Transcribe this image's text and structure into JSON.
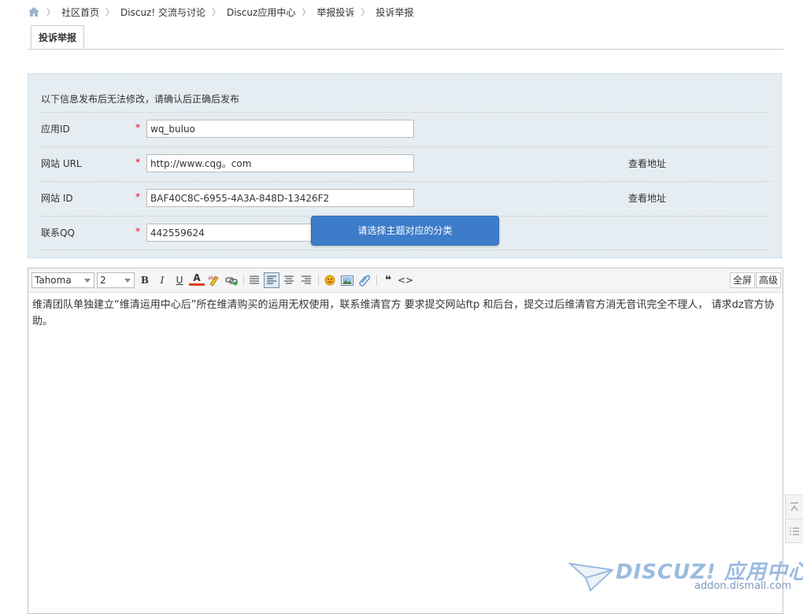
{
  "breadcrumb": {
    "items": [
      "社区首页",
      "Discuz! 交流与讨论",
      "Discuz应用中心",
      "举报投诉",
      "投诉举报"
    ],
    "separator": "〉"
  },
  "tab": {
    "label": "投诉举报"
  },
  "form": {
    "notice": "以下信息发布后无法修改，请确认后正确后发布",
    "required_mark": "*",
    "rows": [
      {
        "label": "应用ID",
        "value": "wq_buluo",
        "link": ""
      },
      {
        "label": "网站 URL",
        "value": "http://www.cqg。com",
        "link": "查看地址"
      },
      {
        "label": "网站 ID",
        "value": "BAF40C8C-6955-4A3A-848D-13426F2",
        "link": "查看地址"
      },
      {
        "label": "联系QQ",
        "value": "442559624",
        "link": ""
      }
    ]
  },
  "tooltip": {
    "text": "请选择主题对应的分类"
  },
  "editor": {
    "font_family": "Tahoma",
    "font_size": "2",
    "fullscreen_label": "全屏",
    "advanced_label": "高级",
    "bold_label": "B",
    "italic_label": "I",
    "underline_label": "U",
    "fontcolor_label": "A",
    "quote_label": "❝",
    "code_label": "<>",
    "content": "维清团队单独建立“维清运用中心后”所在维清购买的运用无权使用，联系维清官方  要求提交网站ftp 和后台，提交过后维清官方消无音讯完全不理人， 请求dz官方协助。"
  },
  "watermark": {
    "brand": "DISCUZ! 应用中心",
    "url": "addon.dismall.com"
  },
  "colors": {
    "panel_bg": "#e5edf2",
    "tooltip_bg": "#3d7cc9",
    "required": "#ff0000"
  }
}
